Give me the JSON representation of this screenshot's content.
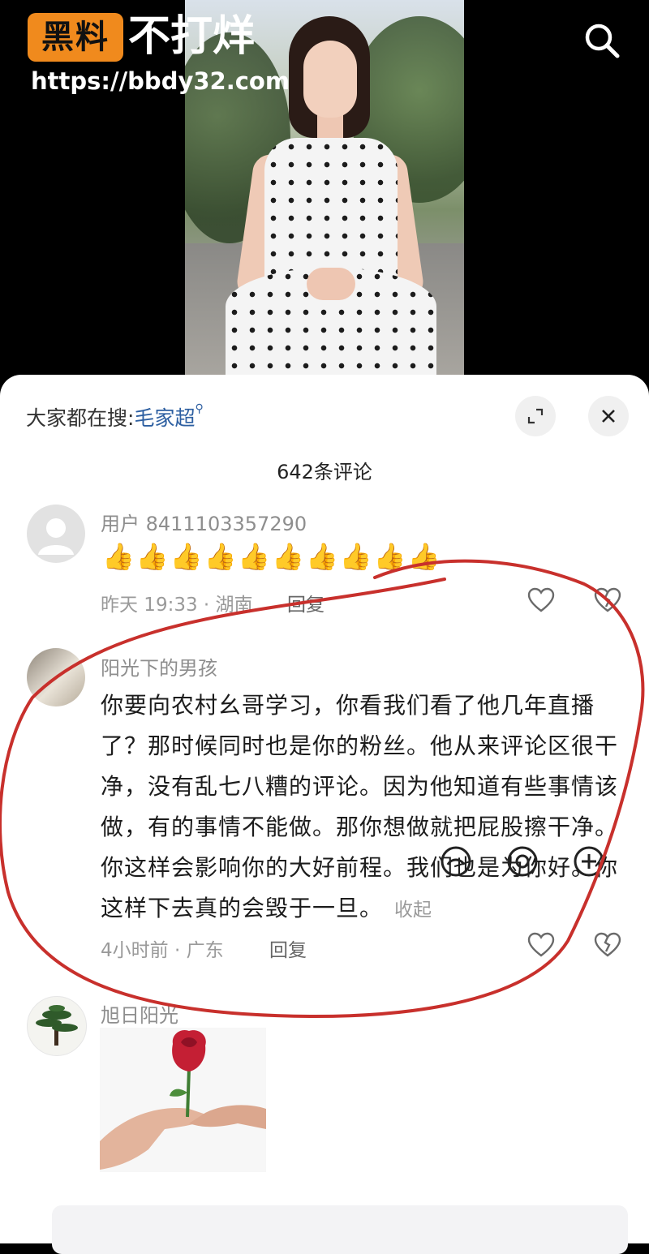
{
  "watermark": {
    "badge": "黑料",
    "title": "不打烊",
    "url": "https://bbdy32.com"
  },
  "sheet": {
    "trending_label": "大家都在搜:",
    "trending_keyword": "毛家超",
    "comment_count": "642条评论"
  },
  "comments": [
    {
      "username": "用户 8411103357290",
      "emoji_text": "👍👍👍👍👍👍👍👍👍👍",
      "meta": "昨天 19:33 · 湖南",
      "reply_label": "回复"
    },
    {
      "username": "阳光下的男孩",
      "text": "你要向农村幺哥学习，你看我们看了他几年直播了？那时候同时也是你的粉丝。他从来评论区很干净，没有乱七八糟的评论。因为他知道有些事情该做，有的事情不能做。那你想做就把屁股擦干净。你这样会影响你的大好前程。我们也是为你好。你这样下去真的会毁于一旦。",
      "collapse_label": "收起",
      "meta": "4小时前 · 广东",
      "reply_label": "回复"
    },
    {
      "username": "旭日阳光"
    }
  ],
  "colors": {
    "badge_orange": "#f08a1d",
    "keyword_blue": "#2d5fa1",
    "annotation_red": "#c8302c"
  }
}
